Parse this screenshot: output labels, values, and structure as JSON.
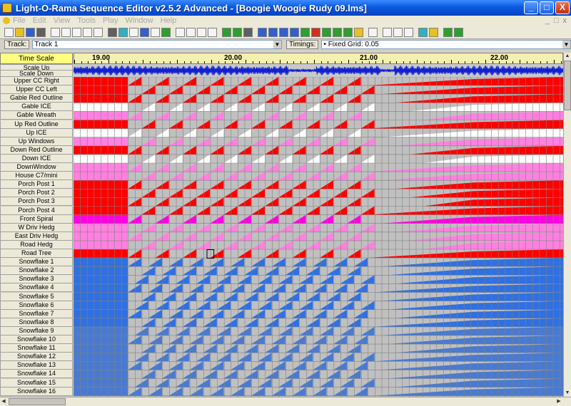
{
  "window": {
    "title": "Light-O-Rama Sequence Editor v2.5.2 Advanced - [Boogie Woogie Rudy 09.lms]",
    "minimize": "_",
    "maximize": "□",
    "close": "X"
  },
  "menu": [
    "File",
    "Edit",
    "View",
    "Tools",
    "Play",
    "Window",
    "Help"
  ],
  "menu_right": [
    "_",
    "□",
    "x"
  ],
  "trackbar": {
    "track_button": "Track:",
    "track_value": "Track 1",
    "timings_button": "Timings:",
    "timings_value": "Fixed Grid: 0.05"
  },
  "header": {
    "time_scale": "Time Scale",
    "scale_up": "Scale Up",
    "scale_down": "Scale Down"
  },
  "time_labels": [
    "19.00",
    "20.00",
    "21.00",
    "22.00"
  ],
  "channels": [
    "Upper CC Right",
    "Upper CC Left",
    "Gable Red Outline",
    "Gable ICE",
    "Gable Wreath",
    "Up Red Outline",
    "Up ICE",
    "Up Windows",
    "Down Red Outline",
    "Down ICE",
    "DownWindow",
    "House C7/mini",
    "Porch Post 1",
    "Porch Post 2",
    "Porch Post 3",
    "Porch Post 4",
    "Front Spiral",
    "W Driv Hedg",
    "East Driv Hedg",
    "Road Hedg",
    "Road Tree",
    "Snowflake 1",
    "Snowflake 2",
    "Snowflake 3",
    "Snowflake 4",
    "Snowflake 5",
    "Snowflake 6",
    "Snowflake 7",
    "Snowflake 8",
    "Snowflake 9",
    "Snowflake 10",
    "Snowflake 11",
    "Snowflake 12",
    "Snowflake 13",
    "Snowflake 14",
    "Snowflake 15",
    "Snowflake 16"
  ],
  "channel_colors": [
    "#ff0000",
    "#ff0000",
    "#ff0000",
    "#ffffff",
    "#ff80e0",
    "#ff0000",
    "#ffffff",
    "#ff80e0",
    "#ff0000",
    "#ffffff",
    "#ff80e0",
    "#ff80e0",
    "#ff0000",
    "#ff0000",
    "#ff0000",
    "#ff0000",
    "#ff00e0",
    "#ff80e0",
    "#ff80e0",
    "#ff80e0",
    "#ff0000",
    "#3070e0",
    "#3070e0",
    "#3070e0",
    "#3070e0",
    "#3070e0",
    "#3070e0",
    "#3070e0",
    "#3070e0",
    "#4a7ad0",
    "#4a7ad0",
    "#4a7ad0",
    "#4a7ad0",
    "#4a7ad0",
    "#4a7ad0",
    "#4a7ad0",
    "#4a7ad0"
  ],
  "colors": {
    "grid_bg": "#c0c0c0",
    "waveform": "#1020d0",
    "timescale_bg": "#f4f0b0",
    "name_header_bg": "#ffff80"
  }
}
